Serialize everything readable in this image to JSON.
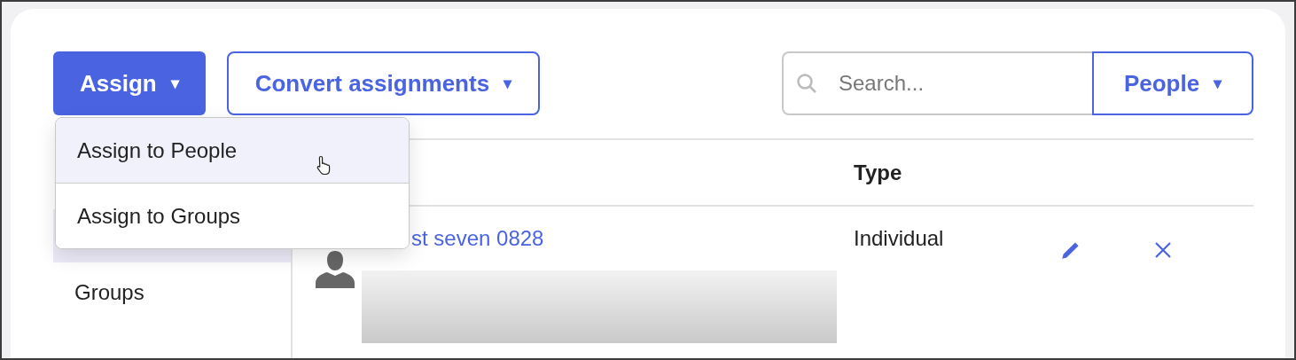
{
  "toolbar": {
    "assign_button": {
      "label": "Assign",
      "caret": "▾"
    },
    "convert_button": {
      "label": "Convert assignments",
      "caret": "▾"
    },
    "search": {
      "placeholder": "Search..."
    },
    "scope_button": {
      "label": "People",
      "caret": "▾"
    }
  },
  "assign_menu": {
    "items": [
      {
        "label": "Assign to People",
        "selected": true
      },
      {
        "label": "Assign to Groups",
        "selected": false
      }
    ]
  },
  "sidebar": {
    "items": [
      {
        "selected": true
      },
      {
        "label": "Groups",
        "selected": false
      }
    ]
  },
  "table": {
    "columns": [
      {
        "label": "Type"
      }
    ],
    "rows": [
      {
        "name": "st seven 0828",
        "type": "Individual"
      }
    ]
  }
}
